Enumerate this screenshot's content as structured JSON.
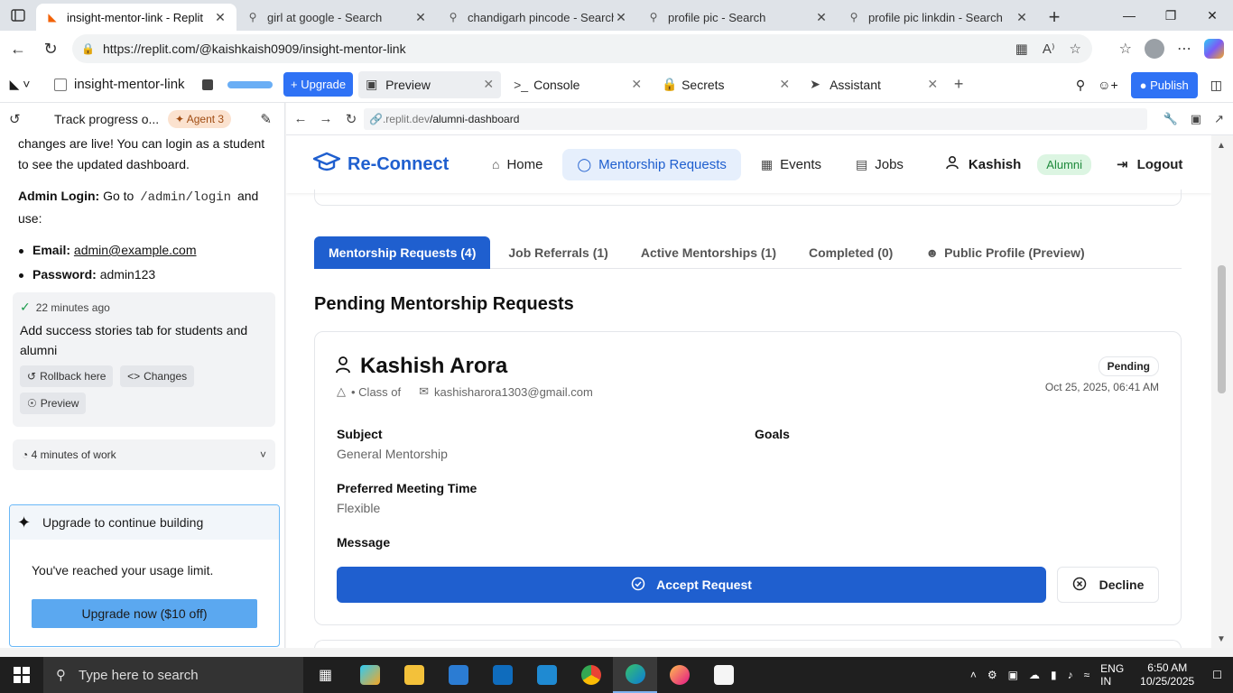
{
  "browser": {
    "tabs": [
      {
        "title": "insight-mentor-link - Replit",
        "active": true
      },
      {
        "title": "girl at google - Search",
        "active": false
      },
      {
        "title": "chandigarh pincode - Search",
        "active": false
      },
      {
        "title": "profile pic - Search",
        "active": false
      },
      {
        "title": "profile pic linkdin - Search",
        "active": false
      }
    ],
    "url": "https://replit.com/@kaishkaish0909/insight-mentor-link"
  },
  "replit": {
    "project_name": "insight-mentor-link",
    "upgrade_label": "Upgrade",
    "tabs": [
      {
        "label": "Preview",
        "icon": "monitor-icon",
        "active": true
      },
      {
        "label": "Console",
        "icon": "terminal-icon",
        "active": false
      },
      {
        "label": "Secrets",
        "icon": "lock-icon",
        "active": false
      },
      {
        "label": "Assistant",
        "icon": "assistant-icon",
        "active": false
      }
    ],
    "publish_label": "Publish"
  },
  "chat": {
    "title": "Track progress o...",
    "agent_badge": "Agent 3",
    "intro": "changes are live! You can login as a student to see the updated dashboard.",
    "admin_label": "Admin Login:",
    "admin_text_pre": "Go to",
    "admin_path": "/admin/login",
    "admin_text_post": "and use:",
    "email_label": "Email:",
    "email_value": "admin@example.com",
    "password_label": "Password:",
    "password_value": "admin123",
    "checkpoint": {
      "time": "22 minutes ago",
      "description": "Add success stories tab for students and alumni",
      "rollback_label": "Rollback here",
      "changes_label": "Changes",
      "preview_label": "Preview"
    },
    "work_label": "4 minutes of work",
    "upgrade_box": {
      "title": "Upgrade to continue building",
      "message": "You've reached your usage limit.",
      "button": "Upgrade now ($10 off)"
    }
  },
  "preview": {
    "url_dim": ".replit.dev",
    "url_path": "/alumni-dashboard"
  },
  "site": {
    "brand": "Re-Connect",
    "nav": [
      {
        "label": "Home",
        "icon": "home-icon",
        "active": false
      },
      {
        "label": "Mentorship Requests",
        "icon": "chat-icon",
        "active": true
      },
      {
        "label": "Events",
        "icon": "calendar-icon",
        "active": false
      },
      {
        "label": "Jobs",
        "icon": "briefcase-icon",
        "active": false
      }
    ],
    "user_name": "Kashish",
    "role_badge": "Alumni",
    "logout_label": "Logout",
    "tabs": [
      {
        "label": "Mentorship Requests (4)",
        "active": true
      },
      {
        "label": "Job Referrals (1)",
        "active": false
      },
      {
        "label": "Active Mentorships (1)",
        "active": false
      },
      {
        "label": "Completed (0)",
        "active": false
      },
      {
        "label": "Public Profile (Preview)",
        "active": false
      }
    ],
    "section_title": "Pending Mentorship Requests",
    "request": {
      "name": "Kashish Arora",
      "class_text": "• Class of",
      "email": "kashisharora1303@gmail.com",
      "status": "Pending",
      "date": "Oct 25, 2025, 06:41 AM",
      "subject_label": "Subject",
      "subject_value": "General Mentorship",
      "goals_label": "Goals",
      "meeting_label": "Preferred Meeting Time",
      "meeting_value": "Flexible",
      "message_label": "Message",
      "accept_label": "Accept Request",
      "decline_label": "Decline"
    }
  },
  "taskbar": {
    "search_placeholder": "Type here to search",
    "lang_top": "ENG",
    "lang_bottom": "IN",
    "time": "6:50 AM",
    "date": "10/25/2025"
  },
  "colors": {
    "primary": "#1f5fcf",
    "replit_blue": "#2f72f5",
    "alumni_green": "#1f8a3c"
  }
}
